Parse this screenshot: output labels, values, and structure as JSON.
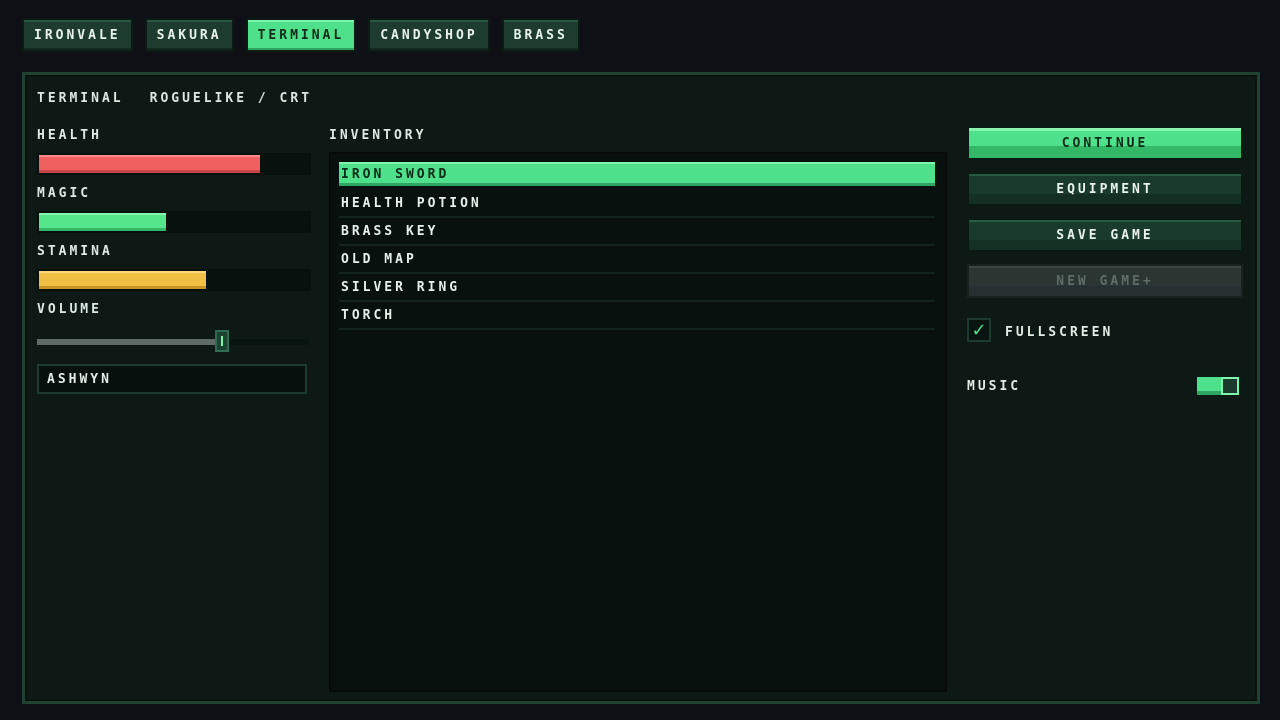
{
  "tabs": [
    {
      "label": "IRONVALE",
      "active": false
    },
    {
      "label": "SAKURA",
      "active": false
    },
    {
      "label": "TERMINAL",
      "active": true
    },
    {
      "label": "CANDYSHOP",
      "active": false
    },
    {
      "label": "BRASS",
      "active": false
    }
  ],
  "header": {
    "theme": "TERMINAL",
    "subtitle": "ROGUELIKE / CRT"
  },
  "stats": {
    "health": {
      "label": "HEALTH",
      "fraction": 0.82,
      "color": "#f06060"
    },
    "magic": {
      "label": "MAGIC",
      "fraction": 0.47,
      "color": "#55e68c"
    },
    "stamina": {
      "label": "STAMINA",
      "fraction": 0.62,
      "color": "#f2c044"
    }
  },
  "volume": {
    "label": "VOLUME",
    "value": 0.68
  },
  "name_input": {
    "value": "ASHWYN"
  },
  "inventory": {
    "label": "INVENTORY",
    "items": [
      "IRON SWORD",
      "HEALTH POTION",
      "BRASS KEY",
      "OLD MAP",
      "SILVER RING",
      "TORCH"
    ],
    "selected_index": 0
  },
  "menu": {
    "continue": "CONTINUE",
    "equipment": "EQUIPMENT",
    "save_game": "SAVE GAME",
    "new_game_plus": "NEW GAME+"
  },
  "settings": {
    "fullscreen": {
      "label": "FULLSCREEN",
      "checked": true,
      "check_glyph": "✓"
    },
    "music": {
      "label": "MUSIC",
      "on": true
    }
  },
  "colors": {
    "accent": "#4fe08c",
    "panel": "#0e1915",
    "background": "#0f0f16"
  }
}
